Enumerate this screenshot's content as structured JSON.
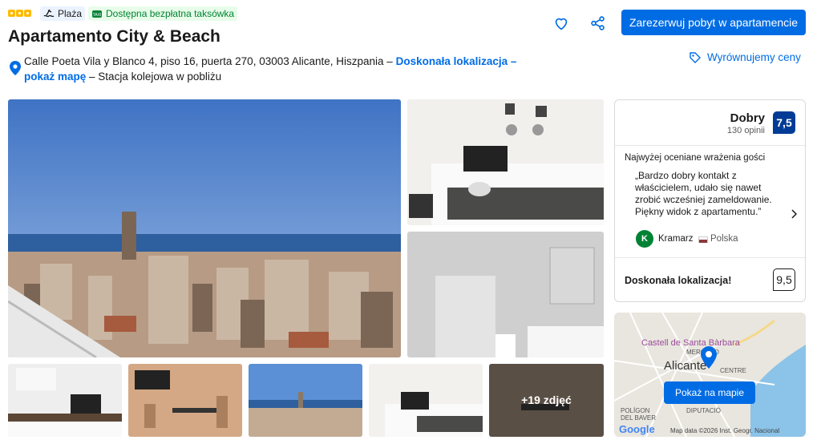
{
  "badges": {
    "beach": "Plaża",
    "taxi": "Dostępna bezpłatna taksówka"
  },
  "title": "Apartamento City & Beach",
  "address": {
    "text": "Calle Poeta Vila y Blanco 4, piso 16, puerta 270, 03003 Alicante, Hiszpania –",
    "link": "Doskonała lokalizacja – pokaż mapę",
    "suffix": "– Stacja kolejowa w pobliżu"
  },
  "actions": {
    "reserve": "Zarezerwuj pobyt w apartamencie",
    "price_match": "Wyrównujemy ceny"
  },
  "gallery": {
    "more": "+19 zdjęć"
  },
  "review": {
    "rating_word": "Dobry",
    "count": "130 opinii",
    "score": "7,5",
    "heading": "Najwyżej oceniane wrażenia gości",
    "quote": "„Bardzo dobry kontakt z właścicielem, udało się nawet zrobić wcześniej zameldowanie. Piękny widok z apartamentu.”",
    "author_initial": "K",
    "author": "Kramarz",
    "country": "Polska",
    "location_label": "Doskonała lokalizacja!",
    "location_score": "9,5"
  },
  "map": {
    "button": "Pokaż na mapie",
    "castle": "Castell de Santa Bàrbara",
    "label_mercado": "MERCADO",
    "label_city": "Alicante",
    "label_centre": "CENTRE",
    "label_poligon": "POLÍGON",
    "label_baver": "DEL BAVER",
    "label_diputacio": "DIPUTACIÓ",
    "attribution": "Map data ©2026 Inst. Geogr. Nacional",
    "google": "Google"
  }
}
